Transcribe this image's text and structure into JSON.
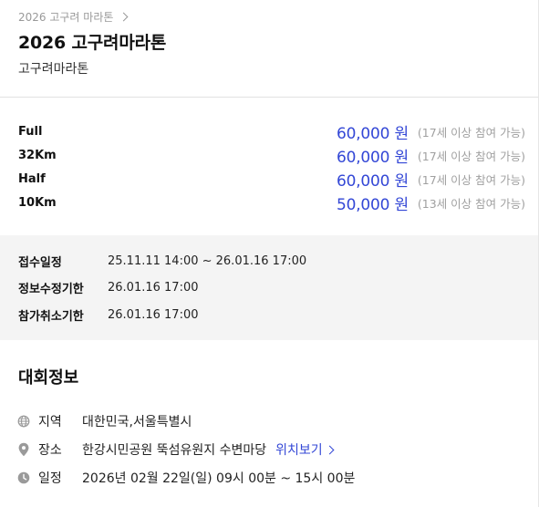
{
  "breadcrumb": {
    "label": "2026 고구려 마라톤"
  },
  "event": {
    "title": "2026 고구려마라톤",
    "subtitle": "고구려마라톤"
  },
  "prices": [
    {
      "category": "Full",
      "amount": "60,000 원",
      "age": "(17세 이상 참여 가능)"
    },
    {
      "category": "32Km",
      "amount": "60,000 원",
      "age": "(17세 이상 참여 가능)"
    },
    {
      "category": "Half",
      "amount": "60,000 원",
      "age": "(17세 이상 참여 가능)"
    },
    {
      "category": "10Km",
      "amount": "50,000 원",
      "age": "(13세 이상 참여 가능)"
    }
  ],
  "schedule": [
    {
      "label": "접수일정",
      "value": "25.11.11 14:00 ~ 26.01.16 17:00"
    },
    {
      "label": "정보수정기한",
      "value": "26.01.16 17:00"
    },
    {
      "label": "참가취소기한",
      "value": "26.01.16 17:00"
    }
  ],
  "info": {
    "section_title": "대회정보",
    "region": {
      "icon": "globe-icon",
      "label": "지역",
      "value": "대한민국,서울특별시"
    },
    "venue": {
      "icon": "location-pin-icon",
      "label": "장소",
      "value": "한강시민공원 뚝섬유원지 수변마당",
      "link": "위치보기"
    },
    "date": {
      "icon": "clock-icon",
      "label": "일정",
      "value": "2026년 02월 22일(일) 09시 00분 ~ 15시 00분"
    }
  },
  "colors": {
    "accent": "#3347d6",
    "muted": "#a0a0a0",
    "panel": "#f4f4f4"
  }
}
